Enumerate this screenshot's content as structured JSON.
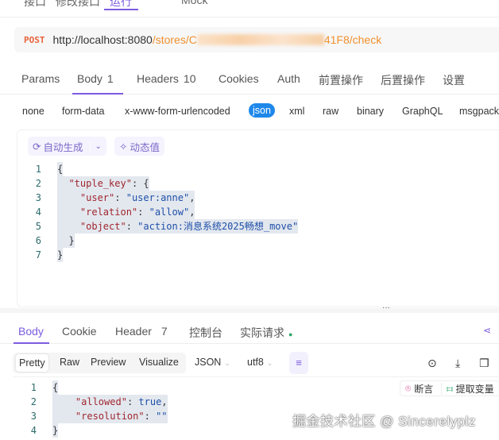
{
  "top_tabs": [
    "接口",
    "修改接口",
    "运行",
    "Mock"
  ],
  "url": {
    "method": "POST",
    "host": "http://localhost:8080",
    "path_start": "/stores/C",
    "path_end": "41F8/check"
  },
  "request_tabs": [
    {
      "label": "Params"
    },
    {
      "label": "Body",
      "count": "1"
    },
    {
      "label": "Headers",
      "count": "10"
    },
    {
      "label": "Cookies"
    },
    {
      "label": "Auth"
    },
    {
      "label": "前置操作"
    },
    {
      "label": "后置操作"
    },
    {
      "label": "设置"
    }
  ],
  "body_types": [
    "none",
    "form-data",
    "x-www-form-urlencoded",
    "json",
    "xml",
    "raw",
    "binary",
    "GraphQL",
    "msgpack"
  ],
  "editor_toolbar": {
    "auto_generate": "自动生成",
    "dynamic_value": "动态值"
  },
  "request_code": [
    {
      "n": "1",
      "t": [
        [
          "p",
          "{"
        ]
      ]
    },
    {
      "n": "2",
      "t": [
        [
          "p",
          "  "
        ],
        [
          "k",
          "\"tuple_key\""
        ],
        [
          "p",
          ": {"
        ]
      ]
    },
    {
      "n": "3",
      "t": [
        [
          "p",
          "    "
        ],
        [
          "k",
          "\"user\""
        ],
        [
          "p",
          ": "
        ],
        [
          "s",
          "\"user:anne\""
        ],
        [
          "p",
          ","
        ]
      ]
    },
    {
      "n": "4",
      "t": [
        [
          "p",
          "    "
        ],
        [
          "k",
          "\"relation\""
        ],
        [
          "p",
          ": "
        ],
        [
          "s",
          "\"allow\""
        ],
        [
          "p",
          ","
        ]
      ]
    },
    {
      "n": "5",
      "t": [
        [
          "p",
          "    "
        ],
        [
          "k",
          "\"object\""
        ],
        [
          "p",
          ": "
        ],
        [
          "s",
          "\"action:消息系统2025畅想_move\""
        ]
      ]
    },
    {
      "n": "6",
      "t": [
        [
          "p",
          "  }"
        ]
      ]
    },
    {
      "n": "7",
      "t": [
        [
          "p",
          "}"
        ]
      ]
    }
  ],
  "response_tabs": [
    {
      "label": "Body"
    },
    {
      "label": "Cookie"
    },
    {
      "label": "Header",
      "count": "7"
    },
    {
      "label": "控制台"
    },
    {
      "label": "实际请求"
    }
  ],
  "format_tabs": [
    "Pretty",
    "Raw",
    "Preview",
    "Visualize"
  ],
  "format_select": "JSON",
  "encoding_select": "utf8",
  "response_actions": {
    "assert": "断言",
    "extract": "提取变量"
  },
  "response_code": [
    {
      "n": "1",
      "t": [
        [
          "p",
          "{"
        ]
      ]
    },
    {
      "n": "2",
      "t": [
        [
          "p",
          "    "
        ],
        [
          "k",
          "\"allowed\""
        ],
        [
          "p",
          ": "
        ],
        [
          "b",
          "true"
        ],
        [
          "p",
          ","
        ]
      ]
    },
    {
      "n": "3",
      "t": [
        [
          "p",
          "    "
        ],
        [
          "k",
          "\"resolution\""
        ],
        [
          "p",
          ": "
        ],
        [
          "s",
          "\"\""
        ]
      ]
    },
    {
      "n": "4",
      "t": [
        [
          "p",
          "}"
        ]
      ]
    }
  ],
  "watermark": "掘金技术社区 @ Sincerelyplz",
  "colors": {
    "accent": "#7c5ce0",
    "method": "#e8623a",
    "json_pill": "#1e88ea",
    "count": "#2aa56a"
  }
}
